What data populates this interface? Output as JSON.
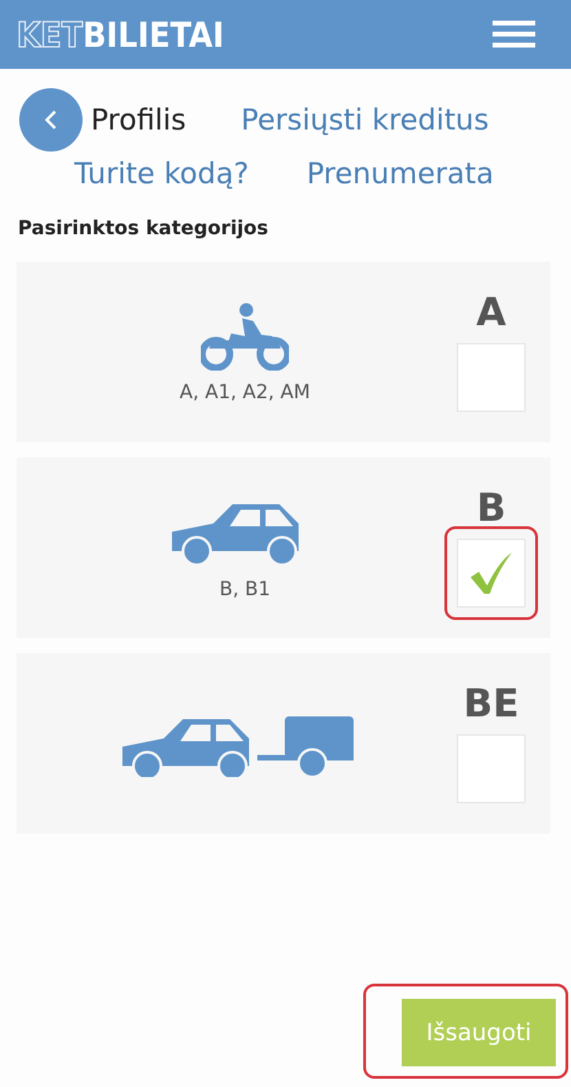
{
  "header": {
    "logo_outlined": "KET",
    "logo_solid": "BILIETAI"
  },
  "nav": [
    {
      "label": "Profilis",
      "selected": true
    },
    {
      "label": "Persiųsti kreditus",
      "selected": false
    },
    {
      "label": "Turite kodą?",
      "selected": false
    },
    {
      "label": "Prenumerata",
      "selected": false
    }
  ],
  "section_title": "Pasirinktos kategorijos",
  "categories": [
    {
      "kind": "motorcycle",
      "letter": "A",
      "subcategories": "A, A1, A2, AM",
      "checked": false,
      "highlighted": false
    },
    {
      "kind": "car",
      "letter": "B",
      "subcategories": "B, B1",
      "checked": true,
      "highlighted": true
    },
    {
      "kind": "trailer",
      "letter": "BE",
      "checked": false,
      "highlighted": false
    }
  ],
  "save_button": {
    "label": "Išsaugoti",
    "highlighted": true
  }
}
